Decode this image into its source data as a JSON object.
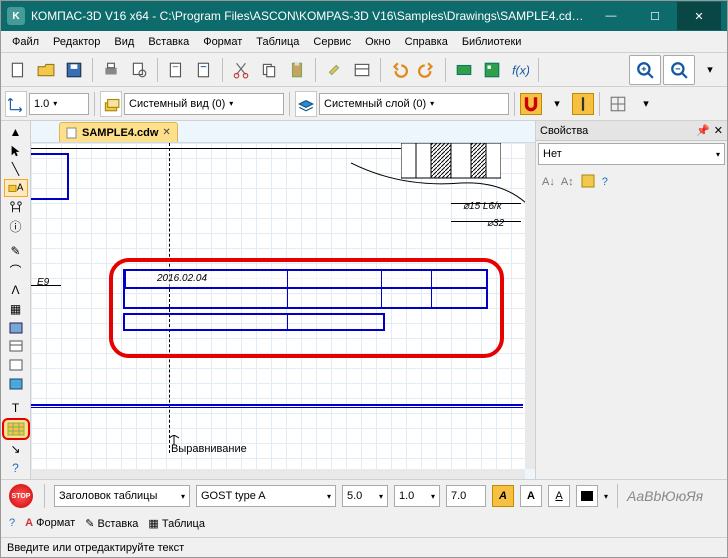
{
  "titlebar": {
    "app_icon_text": "K",
    "title": "КОМПАС-3D V16  x64 - C:\\Program Files\\ASCON\\KOMPAS-3D V16\\Samples\\Drawings\\SAMPLE4.cdw (то...",
    "min": "—",
    "max": "☐",
    "close": "✕"
  },
  "menu": {
    "file": "Файл",
    "edit": "Редактор",
    "view": "Вид",
    "insert": "Вставка",
    "format": "Формат",
    "table": "Таблица",
    "service": "Сервис",
    "window": "Окно",
    "help": "Справка",
    "libraries": "Библиотеки"
  },
  "toolbar2": {
    "scale": "1.0",
    "view": "Системный вид (0)",
    "layer": "Системный слой (0)"
  },
  "tab": {
    "label": "SAMPLE4.cdw"
  },
  "canvas": {
    "e9": "E9",
    "date": "2016.02.04",
    "align": "Выравнивание",
    "phi15": "⌀15 L6/к",
    "phi32": "⌀32"
  },
  "properties": {
    "title": "Свойства",
    "none": "Нет"
  },
  "bottom": {
    "header_style": "Заголовок таблицы",
    "font": "GOST type A",
    "size": "5.0",
    "stretch": "1.0",
    "spacing": "7.0",
    "stop": "STOP",
    "tab_format": "Формат",
    "tab_insert": "Вставка",
    "tab_table": "Таблица",
    "sample": "AaBbЮюЯя"
  },
  "status": {
    "text": "Введите или отредактируйте текст"
  }
}
